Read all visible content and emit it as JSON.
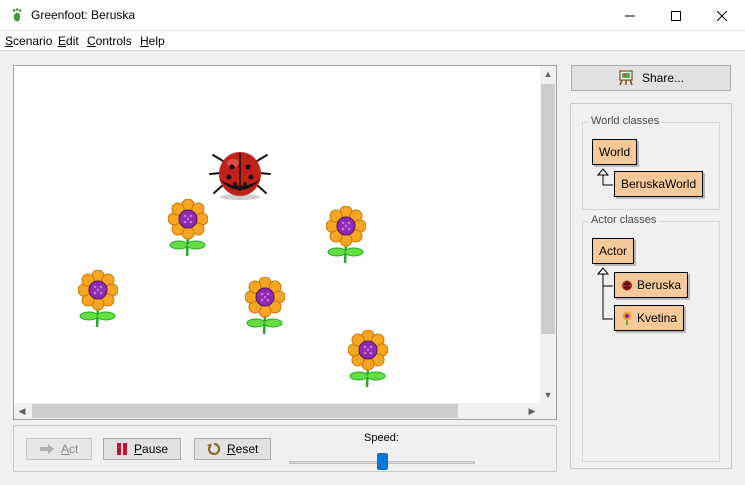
{
  "window": {
    "title": "Greenfoot: Beruska",
    "app_icon": "footprint-icon",
    "controls": [
      "minimize-icon",
      "maximize-icon",
      "close-icon"
    ]
  },
  "menu": {
    "items": [
      {
        "label": "Scenario",
        "mnemonic": "S",
        "rest": "cenario"
      },
      {
        "label": "Edit",
        "mnemonic": "E",
        "rest": "dit"
      },
      {
        "label": "Controls",
        "mnemonic": "C",
        "rest": "ontrols"
      },
      {
        "label": "Help",
        "mnemonic": "H",
        "rest": "elp"
      }
    ]
  },
  "world": {
    "actors": [
      {
        "type": "ladybug",
        "name": "Beruska"
      },
      {
        "type": "flower",
        "name": "Kvetina"
      },
      {
        "type": "flower",
        "name": "Kvetina"
      },
      {
        "type": "flower",
        "name": "Kvetina"
      },
      {
        "type": "flower",
        "name": "Kvetina"
      },
      {
        "type": "flower",
        "name": "Kvetina"
      }
    ],
    "flower_colors": {
      "petal": "#f5a623",
      "center": "#8e2bb0",
      "stem": "#22aa22",
      "leaf": "#66dd44"
    },
    "ladybug_color": "#c0221b"
  },
  "controls": {
    "act_label": "Act",
    "act_mnemonic": "A",
    "act_rest": "ct",
    "act_enabled": false,
    "pause_label": "Pause",
    "pause_mnemonic": "P",
    "pause_rest": "ause",
    "reset_label": "Reset",
    "reset_mnemonic": "R",
    "reset_rest": "eset",
    "speed_label": "Speed:",
    "speed_fraction": 0.5
  },
  "sidebar": {
    "share_label": "Share...",
    "world_group_title": "World classes",
    "world_classes": [
      "World",
      "BeruskaWorld"
    ],
    "actor_group_title": "Actor classes",
    "actor_classes": [
      "Actor",
      "Beruska",
      "Kvetina"
    ]
  },
  "colors": {
    "class_box": "#f6c99a",
    "accent": "#0078d7",
    "pause_red": "#c8102e"
  }
}
